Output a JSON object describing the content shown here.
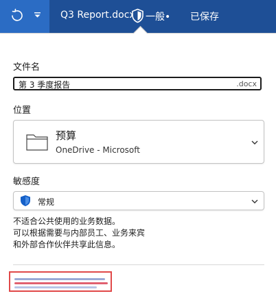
{
  "titlebar": {
    "document_name": "Q3 Report.docx",
    "sensitivity_label": "一般•",
    "save_status": "已保存"
  },
  "panel": {
    "file_name_label": "文件名",
    "file_name_value": "第 3 季度报告",
    "file_extension": ".docx",
    "location_label": "位置",
    "location": {
      "name": "预算",
      "service": "OneDrive - Microsoft"
    },
    "sensitivity_label": "敏感度",
    "sensitivity_value": "常规",
    "sensitivity_description": [
      "不适合公共使用的业务数据。",
      "可以根据需要与内部员工、业务来宾",
      "和外部合作伙伴共享此信息。"
    ]
  },
  "colors": {
    "titlebar": "#1e4f96",
    "titlebar_left": "#2b6cc4",
    "shield_blue": "#1560c8",
    "highlight_border": "#e04848"
  },
  "icons": [
    "refresh-icon",
    "chevron-down-icon",
    "shield-icon",
    "folder-icon"
  ]
}
